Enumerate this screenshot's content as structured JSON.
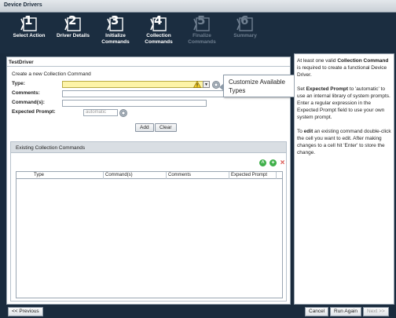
{
  "window": {
    "title": "Device Drivers"
  },
  "wizard": {
    "steps": [
      {
        "num": "1",
        "label": "Select Action",
        "enabled": true
      },
      {
        "num": "2",
        "label": "Driver Details",
        "enabled": true
      },
      {
        "num": "3",
        "label": "Initialize Commands",
        "enabled": true
      },
      {
        "num": "4",
        "label": "Collection Commands",
        "enabled": true
      },
      {
        "num": "5",
        "label": "Finalize Commands",
        "enabled": false
      },
      {
        "num": "6",
        "label": "Summary",
        "enabled": false
      }
    ]
  },
  "panel": {
    "title": "TestDriver",
    "form_title": "Create a new Collection Command",
    "labels": {
      "type": "Type:",
      "comments": "Comments:",
      "commands": "Command(s):",
      "expected_prompt": "Expected Prompt:"
    },
    "expected_prompt_placeholder": "automatic",
    "add_label": "Add",
    "clear_label": "Clear"
  },
  "tooltip": {
    "text": "Customize Available Types"
  },
  "existing": {
    "title": "Existing Collection Commands",
    "columns": [
      "Type",
      "Command(s)",
      "Comments",
      "Expected Prompt"
    ]
  },
  "help": {
    "p1_pre": "At least one valid ",
    "p1_bold": "Collection Command",
    "p1_post": " is required to create a functional Device Driver.",
    "p2_pre": "Set ",
    "p2_bold": "Expected Prompt",
    "p2_post": " to 'automatic' to use an internal library of system prompts. Enter a regular expression in the Expected Prompt field to use your own system prompt.",
    "p3_pre": "To ",
    "p3_bold": "edit",
    "p3_post": " an existing command double-click the cell you want to edit. After making changes to a cell hit 'Enter' to store the change."
  },
  "footer": {
    "previous": "<< Previous",
    "cancel": "Cancel",
    "run_again": "Run Again",
    "next": "Next >>"
  },
  "colors": {
    "background": "#1a2b3d",
    "type_field": "#fdf4a8"
  }
}
